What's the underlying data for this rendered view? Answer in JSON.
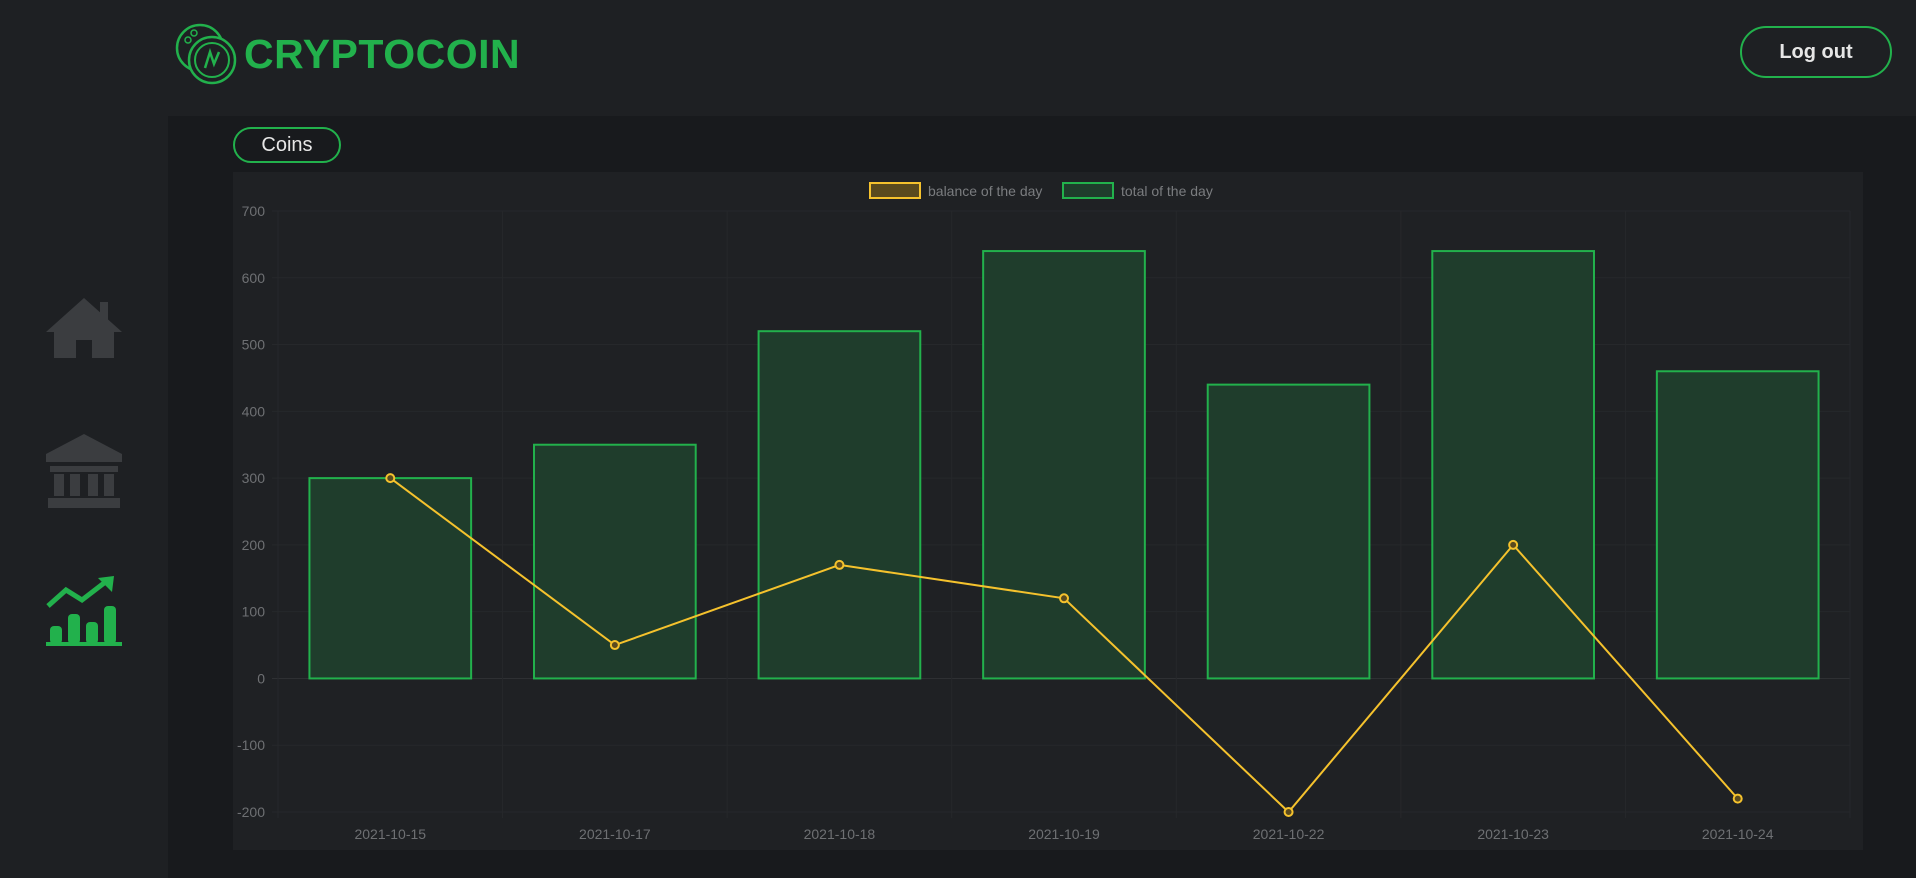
{
  "header": {
    "brand": "CRYPTOCOIN",
    "logout_label": "Log out"
  },
  "sidebar": {
    "items": [
      {
        "icon": "home-icon",
        "active": false
      },
      {
        "icon": "bank-icon",
        "active": false
      },
      {
        "icon": "chart-growth-icon",
        "active": true
      }
    ]
  },
  "tabs": {
    "coins_label": "Coins"
  },
  "colors": {
    "accent": "#22b14c",
    "line": "#f5c22d",
    "bar_fill": "#1f3d2c",
    "inactive_icon": "#3b3d40"
  },
  "chart_data": {
    "type": "bar",
    "categories": [
      "2021-10-15",
      "2021-10-17",
      "2021-10-18",
      "2021-10-19",
      "2021-10-22",
      "2021-10-23",
      "2021-10-24"
    ],
    "series": [
      {
        "name": "balance of the day",
        "type": "line",
        "values": [
          300,
          50,
          170,
          120,
          -200,
          200,
          -180
        ]
      },
      {
        "name": "total of the day",
        "type": "bar",
        "values": [
          300,
          350,
          520,
          640,
          440,
          640,
          460
        ]
      }
    ],
    "yticks": [
      "700",
      "600",
      "500",
      "400",
      "300",
      "200",
      "100",
      "0",
      "-100",
      "-200"
    ],
    "ylim": [
      -200,
      700
    ],
    "legend": "top-center",
    "grid": true
  }
}
